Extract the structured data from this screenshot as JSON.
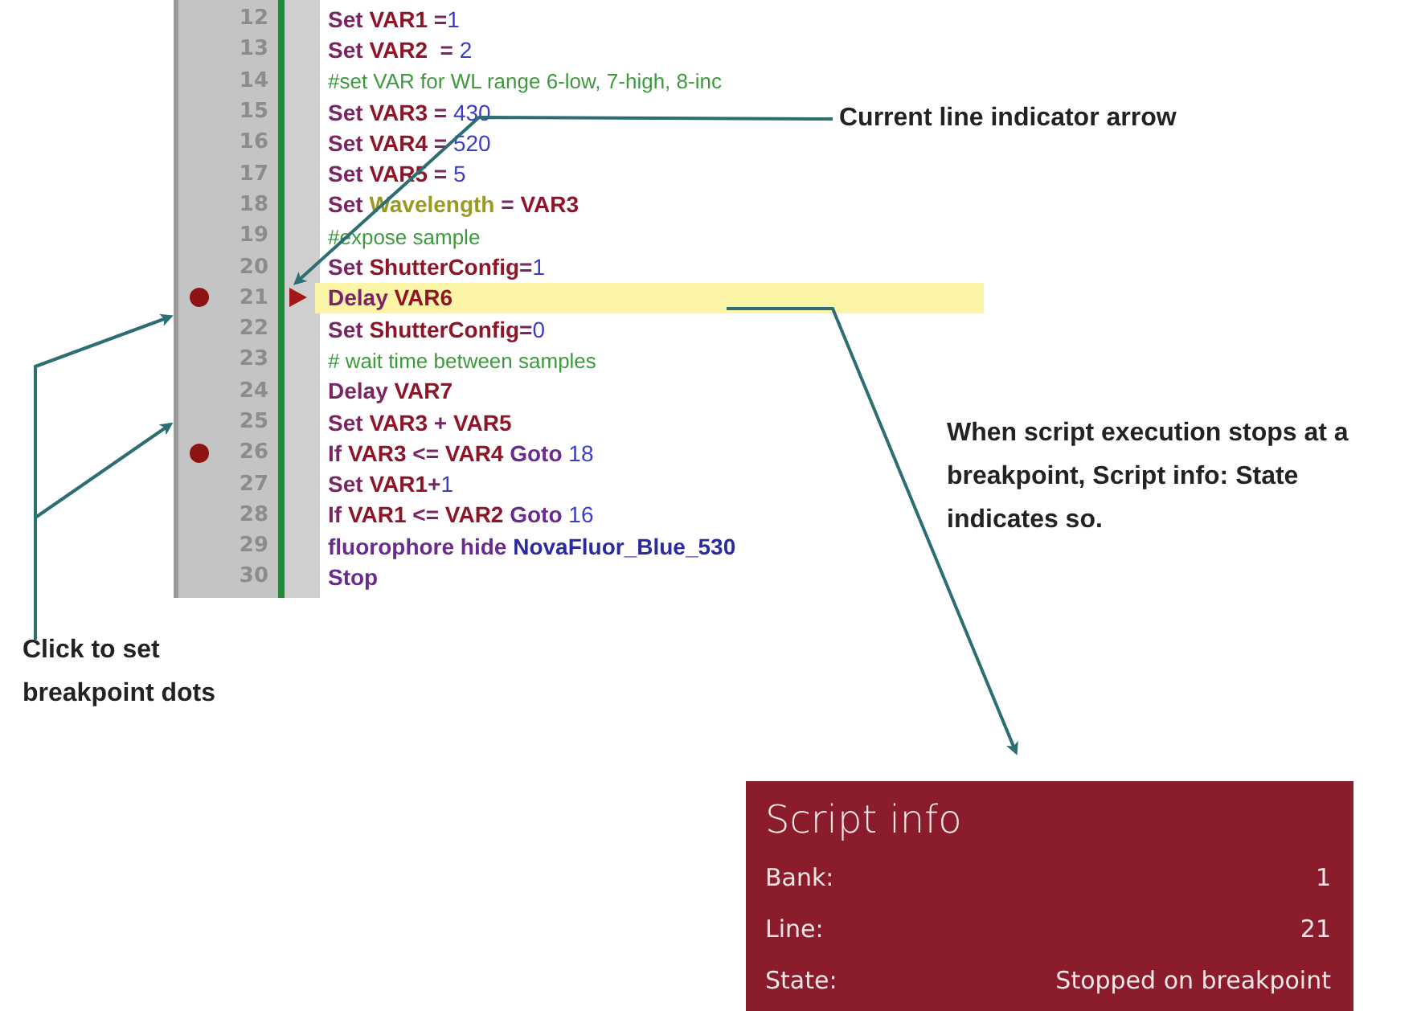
{
  "editor": {
    "lines": [
      {
        "number": "12",
        "breakpoint": false,
        "current": false,
        "tokens": [
          {
            "kind": "cmd",
            "text": "Set "
          },
          {
            "kind": "var",
            "text": "VAR1"
          },
          {
            "kind": "cmd",
            "text": " ="
          },
          {
            "kind": "num",
            "text": "1"
          }
        ]
      },
      {
        "number": "13",
        "breakpoint": false,
        "current": false,
        "tokens": [
          {
            "kind": "cmd",
            "text": "Set "
          },
          {
            "kind": "var",
            "text": "VAR2"
          },
          {
            "kind": "cmd",
            "text": "  = "
          },
          {
            "kind": "num",
            "text": "2"
          }
        ]
      },
      {
        "number": "14",
        "breakpoint": false,
        "current": false,
        "tokens": [
          {
            "kind": "comment",
            "text": "#set VAR for WL range 6-low, 7-high, 8-inc"
          }
        ]
      },
      {
        "number": "15",
        "breakpoint": false,
        "current": false,
        "tokens": [
          {
            "kind": "cmd",
            "text": "Set "
          },
          {
            "kind": "var",
            "text": "VAR3"
          },
          {
            "kind": "cmd",
            "text": " = "
          },
          {
            "kind": "num",
            "text": "430"
          }
        ]
      },
      {
        "number": "16",
        "breakpoint": false,
        "current": false,
        "tokens": [
          {
            "kind": "cmd",
            "text": "Set "
          },
          {
            "kind": "var",
            "text": "VAR4"
          },
          {
            "kind": "cmd",
            "text": " = "
          },
          {
            "kind": "num",
            "text": "520"
          }
        ]
      },
      {
        "number": "17",
        "breakpoint": false,
        "current": false,
        "tokens": [
          {
            "kind": "cmd",
            "text": "Set "
          },
          {
            "kind": "var",
            "text": "VAR5"
          },
          {
            "kind": "cmd",
            "text": " = "
          },
          {
            "kind": "num",
            "text": "5"
          }
        ]
      },
      {
        "number": "18",
        "breakpoint": false,
        "current": false,
        "tokens": [
          {
            "kind": "cmd",
            "text": "Set "
          },
          {
            "kind": "param",
            "text": "Wavelength"
          },
          {
            "kind": "cmd",
            "text": " = "
          },
          {
            "kind": "var",
            "text": "VAR3"
          }
        ]
      },
      {
        "number": "19",
        "breakpoint": false,
        "current": false,
        "tokens": [
          {
            "kind": "comment",
            "text": "#expose sample"
          }
        ]
      },
      {
        "number": "20",
        "breakpoint": false,
        "current": false,
        "tokens": [
          {
            "kind": "cmd",
            "text": "Set "
          },
          {
            "kind": "var",
            "text": "ShutterConfig"
          },
          {
            "kind": "cmd",
            "text": "="
          },
          {
            "kind": "num",
            "text": "1"
          }
        ]
      },
      {
        "number": "21",
        "breakpoint": true,
        "current": true,
        "tokens": [
          {
            "kind": "cmd",
            "text": "Delay "
          },
          {
            "kind": "var",
            "text": "VAR6"
          }
        ]
      },
      {
        "number": "22",
        "breakpoint": false,
        "current": false,
        "tokens": [
          {
            "kind": "cmd",
            "text": "Set "
          },
          {
            "kind": "var",
            "text": "ShutterConfig"
          },
          {
            "kind": "cmd",
            "text": "="
          },
          {
            "kind": "num",
            "text": "0"
          }
        ]
      },
      {
        "number": "23",
        "breakpoint": false,
        "current": false,
        "tokens": [
          {
            "kind": "comment",
            "text": "# wait time between samples"
          }
        ]
      },
      {
        "number": "24",
        "breakpoint": false,
        "current": false,
        "tokens": [
          {
            "kind": "cmd",
            "text": "Delay "
          },
          {
            "kind": "var",
            "text": "VAR7"
          }
        ]
      },
      {
        "number": "25",
        "breakpoint": false,
        "current": false,
        "tokens": [
          {
            "kind": "cmd",
            "text": "Set "
          },
          {
            "kind": "var",
            "text": "VAR3"
          },
          {
            "kind": "cmd",
            "text": " + "
          },
          {
            "kind": "var",
            "text": "VAR5"
          }
        ]
      },
      {
        "number": "26",
        "breakpoint": true,
        "current": false,
        "tokens": [
          {
            "kind": "cmd",
            "text": "If "
          },
          {
            "kind": "var",
            "text": "VAR3"
          },
          {
            "kind": "cmd",
            "text": " <= "
          },
          {
            "kind": "var",
            "text": "VAR4"
          },
          {
            "kind": "kw",
            "text": " Goto "
          },
          {
            "kind": "num",
            "text": "18"
          }
        ]
      },
      {
        "number": "27",
        "breakpoint": false,
        "current": false,
        "tokens": [
          {
            "kind": "cmd",
            "text": "Set "
          },
          {
            "kind": "var",
            "text": "VAR1"
          },
          {
            "kind": "cmd",
            "text": "+"
          },
          {
            "kind": "num",
            "text": "1"
          }
        ]
      },
      {
        "number": "28",
        "breakpoint": false,
        "current": false,
        "tokens": [
          {
            "kind": "cmd",
            "text": "If "
          },
          {
            "kind": "var",
            "text": "VAR1"
          },
          {
            "kind": "cmd",
            "text": " <= "
          },
          {
            "kind": "var",
            "text": "VAR2"
          },
          {
            "kind": "kw",
            "text": " Goto "
          },
          {
            "kind": "num",
            "text": "16"
          }
        ]
      },
      {
        "number": "29",
        "breakpoint": false,
        "current": false,
        "tokens": [
          {
            "kind": "kw",
            "text": "fluorophore hide "
          },
          {
            "kind": "name",
            "text": "NovaFluor_Blue_530"
          }
        ]
      },
      {
        "number": "30",
        "breakpoint": false,
        "current": false,
        "tokens": [
          {
            "kind": "kw",
            "text": "Stop"
          }
        ]
      }
    ]
  },
  "callouts": [
    {
      "kind": "arrow",
      "text": "Current line indicator arrow"
    },
    {
      "kind": "state",
      "text": "When script execution stops at a breakpoint, Script info: State indicates so."
    },
    {
      "kind": "dots",
      "text": "Click to set breakpoint dots"
    }
  ],
  "script_info": {
    "title": "Script info",
    "rows": [
      {
        "label": "Bank:",
        "value": "1"
      },
      {
        "label": "Line:",
        "value": "21"
      },
      {
        "label": "State:",
        "value": "Stopped on breakpoint"
      }
    ]
  }
}
